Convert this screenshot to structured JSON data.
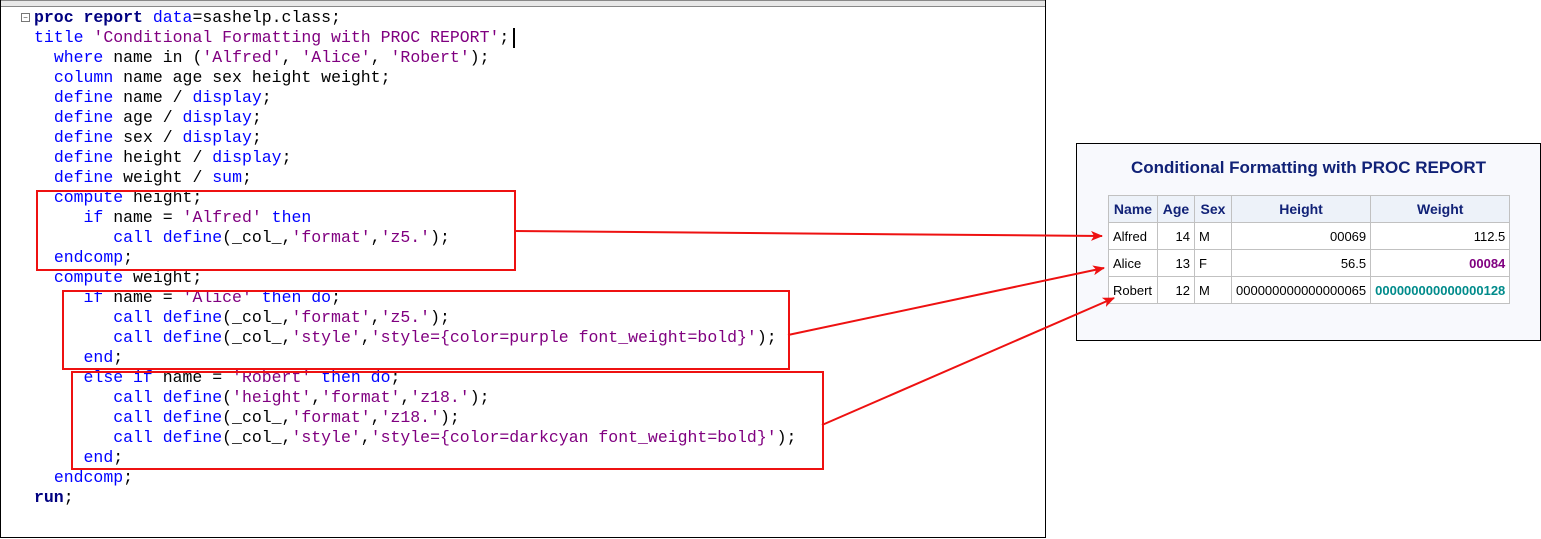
{
  "editor": {
    "code_lines": [
      [
        [
          "bold",
          "proc report "
        ],
        [
          "kw",
          "data"
        ],
        [
          "txt",
          "=sashelp.class;"
        ]
      ],
      [
        [
          "kw",
          "title "
        ],
        [
          "str",
          "'Conditional Formatting with PROC REPORT'"
        ],
        [
          "txt",
          ";"
        ]
      ],
      [
        [
          "txt",
          "  "
        ],
        [
          "kw",
          "where"
        ],
        [
          "txt",
          " name in ("
        ],
        [
          "str",
          "'Alfred'"
        ],
        [
          "txt",
          ", "
        ],
        [
          "str",
          "'Alice'"
        ],
        [
          "txt",
          ", "
        ],
        [
          "str",
          "'Robert'"
        ],
        [
          "txt",
          ");"
        ]
      ],
      [
        [
          "txt",
          "  "
        ],
        [
          "kw",
          "column"
        ],
        [
          "txt",
          " name age sex height weight;"
        ]
      ],
      [
        [
          "txt",
          "  "
        ],
        [
          "kw",
          "define"
        ],
        [
          "txt",
          " name / "
        ],
        [
          "kw",
          "display"
        ],
        [
          "txt",
          ";"
        ]
      ],
      [
        [
          "txt",
          "  "
        ],
        [
          "kw",
          "define"
        ],
        [
          "txt",
          " age / "
        ],
        [
          "kw",
          "display"
        ],
        [
          "txt",
          ";"
        ]
      ],
      [
        [
          "txt",
          "  "
        ],
        [
          "kw",
          "define"
        ],
        [
          "txt",
          " sex / "
        ],
        [
          "kw",
          "display"
        ],
        [
          "txt",
          ";"
        ]
      ],
      [
        [
          "txt",
          "  "
        ],
        [
          "kw",
          "define"
        ],
        [
          "txt",
          " height / "
        ],
        [
          "kw",
          "display"
        ],
        [
          "txt",
          ";"
        ]
      ],
      [
        [
          "txt",
          "  "
        ],
        [
          "kw",
          "define"
        ],
        [
          "txt",
          " weight / "
        ],
        [
          "kw",
          "sum"
        ],
        [
          "txt",
          ";"
        ]
      ],
      [
        [
          "txt",
          "  "
        ],
        [
          "kw",
          "compute"
        ],
        [
          "txt",
          " height;"
        ]
      ],
      [
        [
          "txt",
          "     "
        ],
        [
          "kw",
          "if"
        ],
        [
          "txt",
          " name = "
        ],
        [
          "str",
          "'Alfred'"
        ],
        [
          "txt",
          " "
        ],
        [
          "kw",
          "then"
        ]
      ],
      [
        [
          "txt",
          "        "
        ],
        [
          "kw",
          "call define"
        ],
        [
          "txt",
          "(_col_,"
        ],
        [
          "str",
          "'format'"
        ],
        [
          "txt",
          ","
        ],
        [
          "str",
          "'z5.'"
        ],
        [
          "txt",
          ");"
        ]
      ],
      [
        [
          "txt",
          "  "
        ],
        [
          "kw",
          "endcomp"
        ],
        [
          "txt",
          ";"
        ]
      ],
      [
        [
          "txt",
          "  "
        ],
        [
          "kw",
          "compute"
        ],
        [
          "txt",
          " weight;"
        ]
      ],
      [
        [
          "txt",
          "     "
        ],
        [
          "kw",
          "if"
        ],
        [
          "txt",
          " name = "
        ],
        [
          "str",
          "'Alice'"
        ],
        [
          "txt",
          " "
        ],
        [
          "kw",
          "then do"
        ],
        [
          "txt",
          ";"
        ]
      ],
      [
        [
          "txt",
          "        "
        ],
        [
          "kw",
          "call define"
        ],
        [
          "txt",
          "(_col_,"
        ],
        [
          "str",
          "'format'"
        ],
        [
          "txt",
          ","
        ],
        [
          "str",
          "'z5.'"
        ],
        [
          "txt",
          ");"
        ]
      ],
      [
        [
          "txt",
          "        "
        ],
        [
          "kw",
          "call define"
        ],
        [
          "txt",
          "(_col_,"
        ],
        [
          "str",
          "'style'"
        ],
        [
          "txt",
          ","
        ],
        [
          "str",
          "'style={color=purple font_weight=bold}'"
        ],
        [
          "txt",
          ");"
        ]
      ],
      [
        [
          "txt",
          "     "
        ],
        [
          "kw",
          "end"
        ],
        [
          "txt",
          ";"
        ]
      ],
      [
        [
          "txt",
          "     "
        ],
        [
          "kw",
          "else if"
        ],
        [
          "txt",
          " name = "
        ],
        [
          "str",
          "'Robert'"
        ],
        [
          "txt",
          " "
        ],
        [
          "kw",
          "then do"
        ],
        [
          "txt",
          ";"
        ]
      ],
      [
        [
          "txt",
          "        "
        ],
        [
          "kw",
          "call define"
        ],
        [
          "txt",
          "("
        ],
        [
          "str",
          "'height'"
        ],
        [
          "txt",
          ","
        ],
        [
          "str",
          "'format'"
        ],
        [
          "txt",
          ","
        ],
        [
          "str",
          "'z18.'"
        ],
        [
          "txt",
          ");"
        ]
      ],
      [
        [
          "txt",
          "        "
        ],
        [
          "kw",
          "call define"
        ],
        [
          "txt",
          "(_col_,"
        ],
        [
          "str",
          "'format'"
        ],
        [
          "txt",
          ","
        ],
        [
          "str",
          "'z18.'"
        ],
        [
          "txt",
          ");"
        ]
      ],
      [
        [
          "txt",
          "        "
        ],
        [
          "kw",
          "call define"
        ],
        [
          "txt",
          "(_col_,"
        ],
        [
          "str",
          "'style'"
        ],
        [
          "txt",
          ","
        ],
        [
          "str",
          "'style={color=darkcyan font_weight=bold}'"
        ],
        [
          "txt",
          ");"
        ]
      ],
      [
        [
          "txt",
          "     "
        ],
        [
          "kw",
          "end"
        ],
        [
          "txt",
          ";"
        ]
      ],
      [
        [
          "txt",
          "  "
        ],
        [
          "kw",
          "endcomp"
        ],
        [
          "txt",
          ";"
        ]
      ],
      [
        [
          "bold",
          "run"
        ],
        [
          "txt",
          ";"
        ]
      ]
    ]
  },
  "output": {
    "title": "Conditional Formatting with PROC REPORT",
    "headers": [
      "Name",
      "Age",
      "Sex",
      "Height",
      "Weight"
    ],
    "rows": [
      [
        "Alfred",
        "14",
        "M",
        "00069",
        "112.5"
      ],
      [
        "Alice",
        "13",
        "F",
        "56.5",
        "00084"
      ],
      [
        "Robert",
        "12",
        "M",
        "000000000000000065",
        "000000000000000128"
      ]
    ],
    "colors": {
      "purple": "#800080",
      "darkcyan": "#008b8b",
      "annotation": "#ee1111"
    }
  }
}
